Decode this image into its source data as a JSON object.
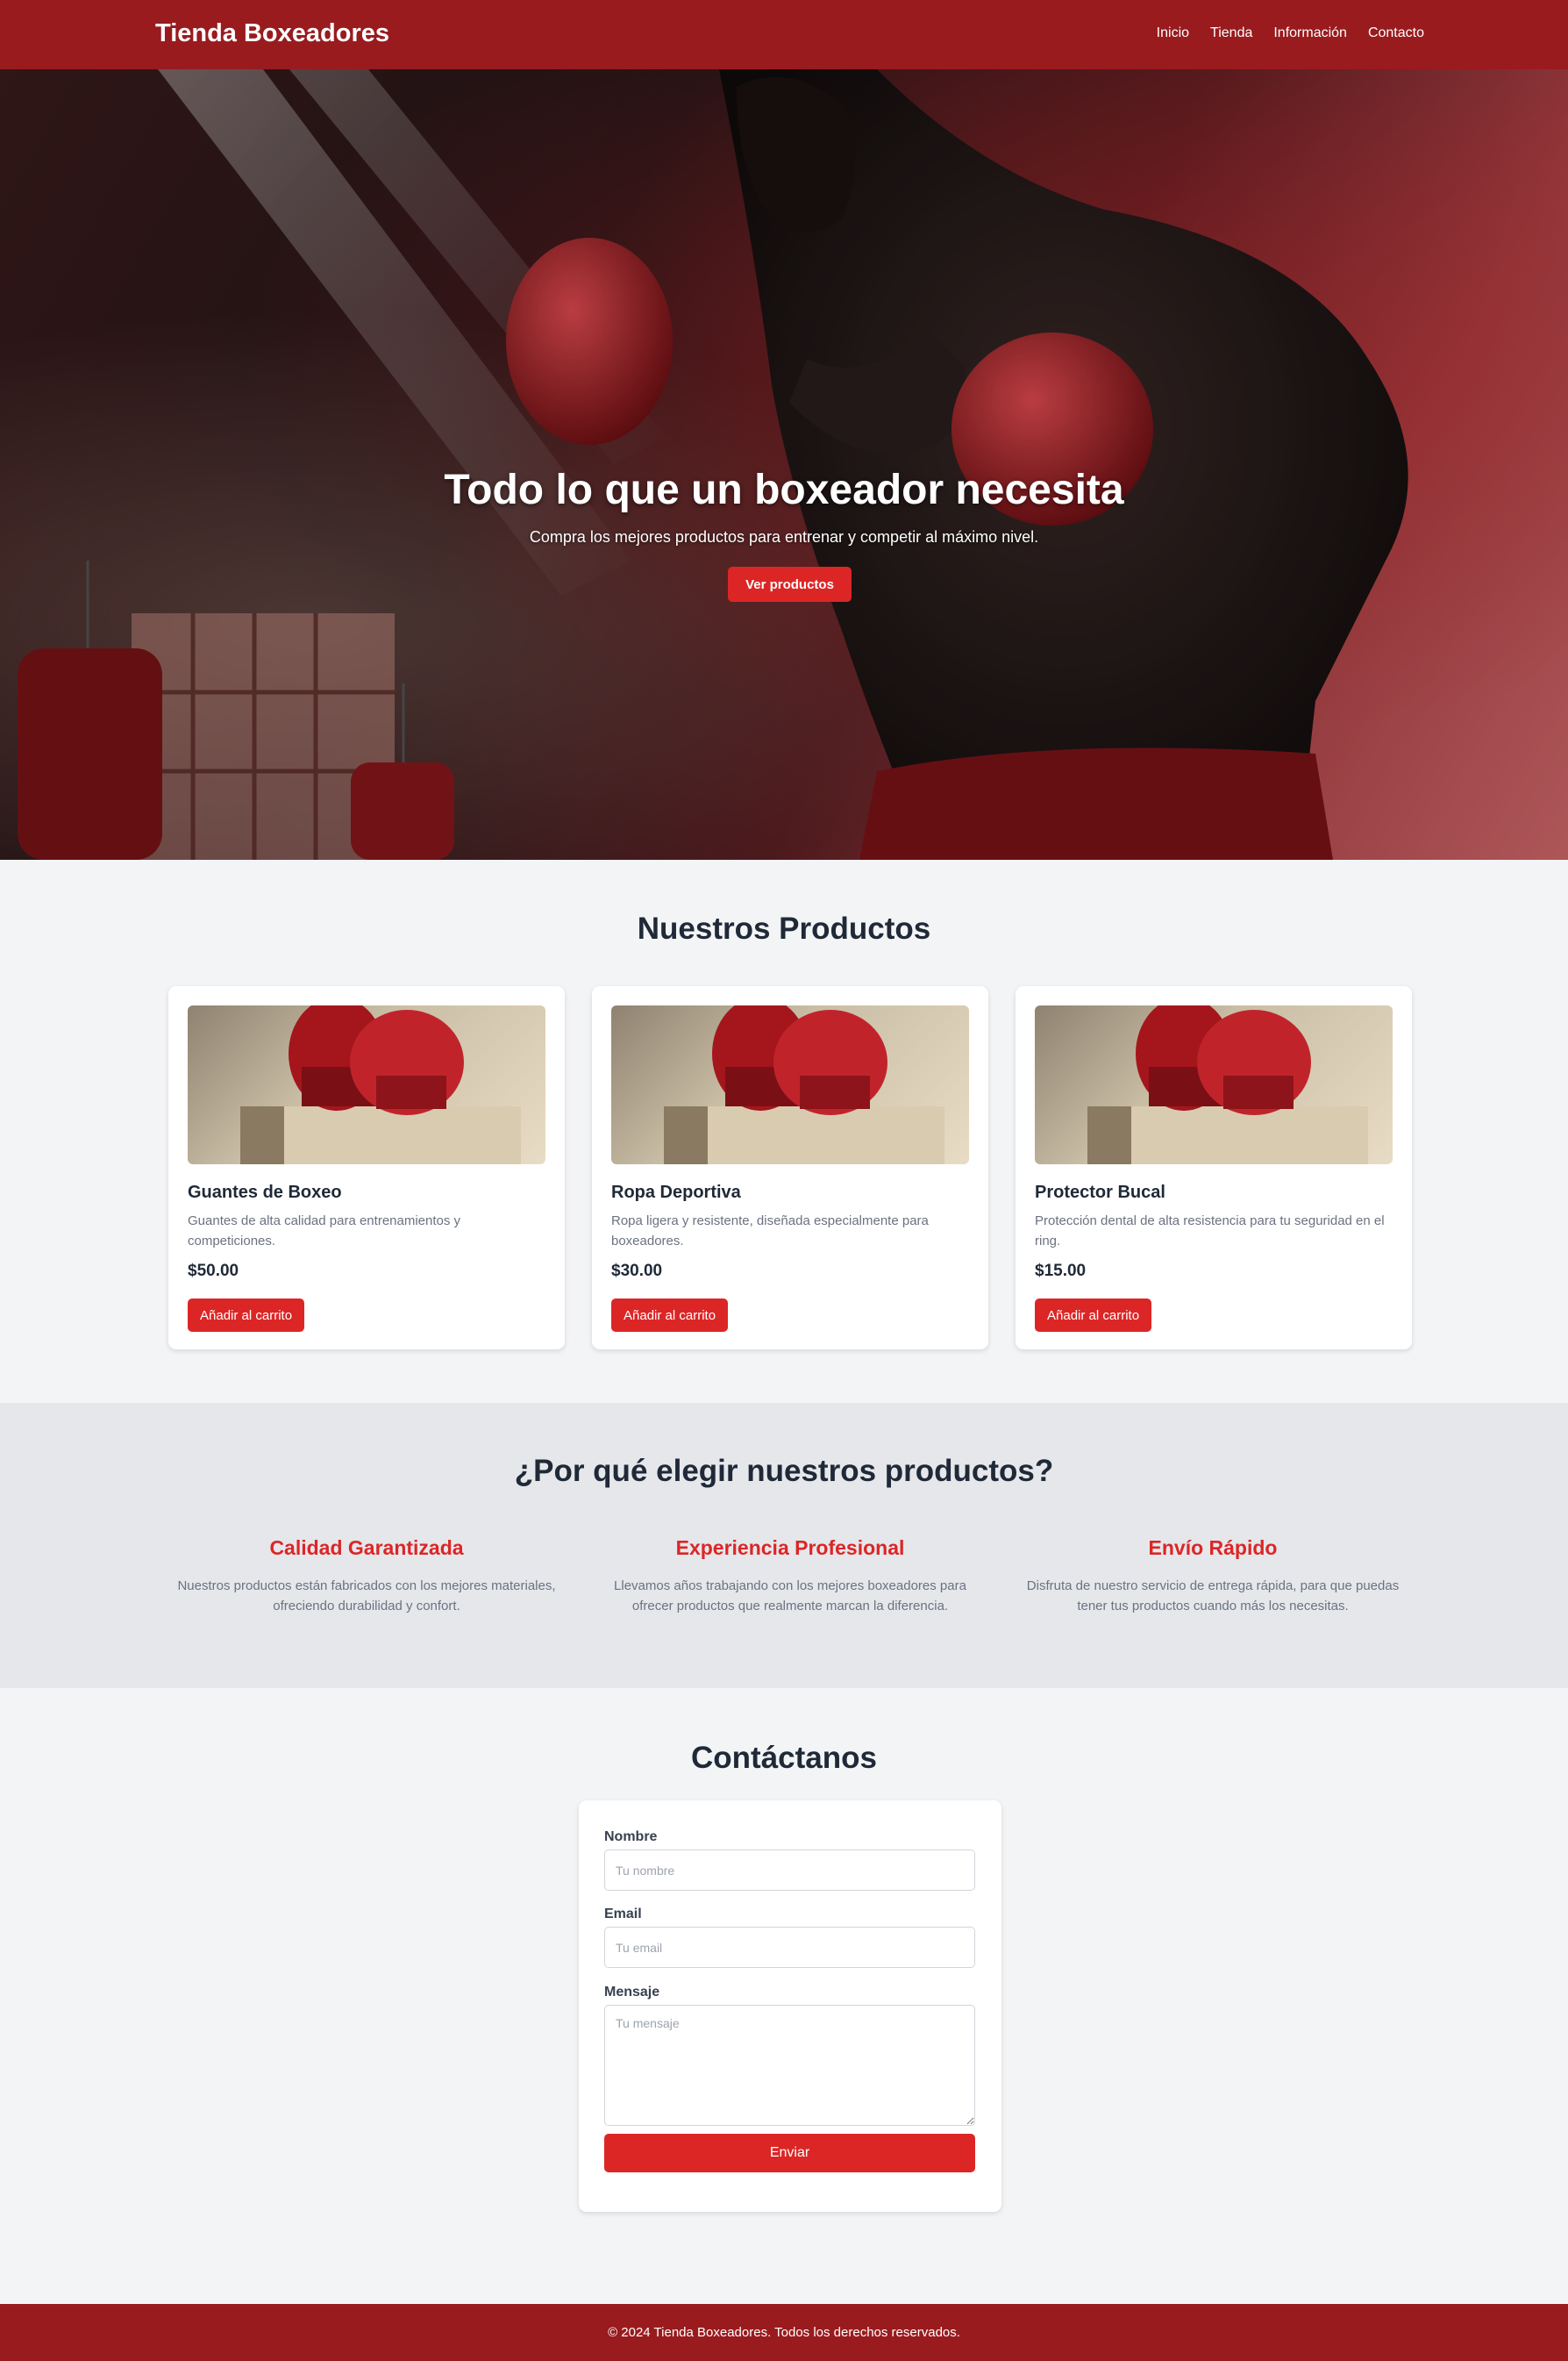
{
  "header": {
    "brand": "Tienda Boxeadores",
    "nav": [
      "Inicio",
      "Tienda",
      "Información",
      "Contacto"
    ]
  },
  "hero": {
    "title": "Todo lo que un boxeador necesita",
    "subtitle": "Compra los mejores productos para entrenar y competir al máximo nivel.",
    "button": "Ver productos"
  },
  "products": {
    "title": "Nuestros Productos",
    "items": [
      {
        "name": "Guantes de Boxeo",
        "description": "Guantes de alta calidad para entrenamientos y competiciones.",
        "price": "$50.00",
        "button": "Añadir al carrito"
      },
      {
        "name": "Ropa Deportiva",
        "description": "Ropa ligera y resistente, diseñada especialmente para boxeadores.",
        "price": "$30.00",
        "button": "Añadir al carrito"
      },
      {
        "name": "Protector Bucal",
        "description": "Protección dental de alta resistencia para tu seguridad en el ring.",
        "price": "$15.00",
        "button": "Añadir al carrito"
      }
    ]
  },
  "why": {
    "title": "¿Por qué elegir nuestros productos?",
    "features": [
      {
        "title": "Calidad Garantizada",
        "text": "Nuestros productos están fabricados con los mejores materiales, ofreciendo durabilidad y confort."
      },
      {
        "title": "Experiencia Profesional",
        "text": "Llevamos años trabajando con los mejores boxeadores para ofrecer productos que realmente marcan la diferencia."
      },
      {
        "title": "Envío Rápido",
        "text": "Disfruta de nuestro servicio de entrega rápida, para que puedas tener tus productos cuando más los necesitas."
      }
    ]
  },
  "contact": {
    "title": "Contáctanos",
    "name_label": "Nombre",
    "name_placeholder": "Tu nombre",
    "email_label": "Email",
    "email_placeholder": "Tu email",
    "message_label": "Mensaje",
    "message_placeholder": "Tu mensaje",
    "submit": "Enviar"
  },
  "footer": {
    "text": "© 2024 Tienda Boxeadores. Todos los derechos reservados."
  },
  "colors": {
    "header_bg": "#991b1e",
    "accent": "#dc2626",
    "page_bg": "#f3f4f6",
    "section_alt_bg": "#e5e7eb"
  }
}
